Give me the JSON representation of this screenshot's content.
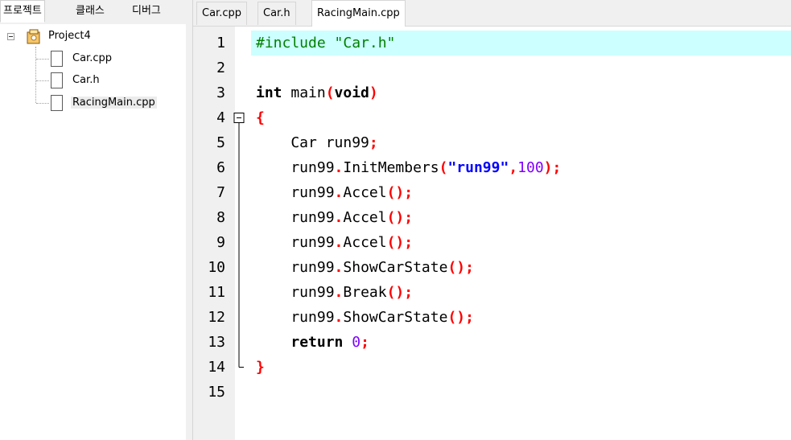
{
  "left_panel": {
    "tabs": [
      {
        "label": "프로젝트",
        "active": true
      },
      {
        "label": "클래스",
        "active": false
      },
      {
        "label": "디버그",
        "active": false
      }
    ],
    "project": {
      "name": "Project4",
      "files": [
        "Car.cpp",
        "Car.h",
        "RacingMain.cpp"
      ],
      "selected": "RacingMain.cpp"
    }
  },
  "editor": {
    "tabs": [
      {
        "label": "Car.cpp",
        "active": false
      },
      {
        "label": "Car.h",
        "active": false
      },
      {
        "label": "RacingMain.cpp",
        "active": true
      }
    ],
    "highlighted_line": 1,
    "colors": {
      "preprocessor": "#008000",
      "operator": "#ff0000",
      "string": "#0000ff",
      "number": "#8000ff",
      "current_line": "#ccffff"
    },
    "fold_marker_lines": [
      4,
      14
    ],
    "lines": [
      {
        "n": "1",
        "tokens": [
          {
            "t": "#include \"Car.h\"",
            "c": "pp"
          }
        ]
      },
      {
        "n": "2",
        "tokens": []
      },
      {
        "n": "3",
        "tokens": [
          {
            "t": "int",
            "c": "kw"
          },
          {
            "t": " main",
            "c": "id"
          },
          {
            "t": "(",
            "c": "op"
          },
          {
            "t": "void",
            "c": "kw"
          },
          {
            "t": ")",
            "c": "op"
          }
        ]
      },
      {
        "n": "4",
        "tokens": [
          {
            "t": "{",
            "c": "op"
          }
        ]
      },
      {
        "n": "5",
        "tokens": [
          {
            "t": "    Car run99",
            "c": "id"
          },
          {
            "t": ";",
            "c": "op"
          }
        ]
      },
      {
        "n": "6",
        "tokens": [
          {
            "t": "    run99",
            "c": "id"
          },
          {
            "t": ".",
            "c": "op"
          },
          {
            "t": "InitMembers",
            "c": "id"
          },
          {
            "t": "(",
            "c": "op"
          },
          {
            "t": "\"run99\"",
            "c": "str"
          },
          {
            "t": ",",
            "c": "op"
          },
          {
            "t": "100",
            "c": "num"
          },
          {
            "t": ");",
            "c": "op"
          }
        ]
      },
      {
        "n": "7",
        "tokens": [
          {
            "t": "    run99",
            "c": "id"
          },
          {
            "t": ".",
            "c": "op"
          },
          {
            "t": "Accel",
            "c": "id"
          },
          {
            "t": "();",
            "c": "op"
          }
        ]
      },
      {
        "n": "8",
        "tokens": [
          {
            "t": "    run99",
            "c": "id"
          },
          {
            "t": ".",
            "c": "op"
          },
          {
            "t": "Accel",
            "c": "id"
          },
          {
            "t": "();",
            "c": "op"
          }
        ]
      },
      {
        "n": "9",
        "tokens": [
          {
            "t": "    run99",
            "c": "id"
          },
          {
            "t": ".",
            "c": "op"
          },
          {
            "t": "Accel",
            "c": "id"
          },
          {
            "t": "();",
            "c": "op"
          }
        ]
      },
      {
        "n": "10",
        "tokens": [
          {
            "t": "    run99",
            "c": "id"
          },
          {
            "t": ".",
            "c": "op"
          },
          {
            "t": "ShowCarState",
            "c": "id"
          },
          {
            "t": "();",
            "c": "op"
          }
        ]
      },
      {
        "n": "11",
        "tokens": [
          {
            "t": "    run99",
            "c": "id"
          },
          {
            "t": ".",
            "c": "op"
          },
          {
            "t": "Break",
            "c": "id"
          },
          {
            "t": "();",
            "c": "op"
          }
        ]
      },
      {
        "n": "12",
        "tokens": [
          {
            "t": "    run99",
            "c": "id"
          },
          {
            "t": ".",
            "c": "op"
          },
          {
            "t": "ShowCarState",
            "c": "id"
          },
          {
            "t": "();",
            "c": "op"
          }
        ]
      },
      {
        "n": "13",
        "tokens": [
          {
            "t": "    ",
            "c": "id"
          },
          {
            "t": "return",
            "c": "kw"
          },
          {
            "t": " ",
            "c": "id"
          },
          {
            "t": "0",
            "c": "num"
          },
          {
            "t": ";",
            "c": "op"
          }
        ]
      },
      {
        "n": "14",
        "tokens": [
          {
            "t": "}",
            "c": "op"
          }
        ]
      },
      {
        "n": "15",
        "tokens": []
      }
    ]
  }
}
